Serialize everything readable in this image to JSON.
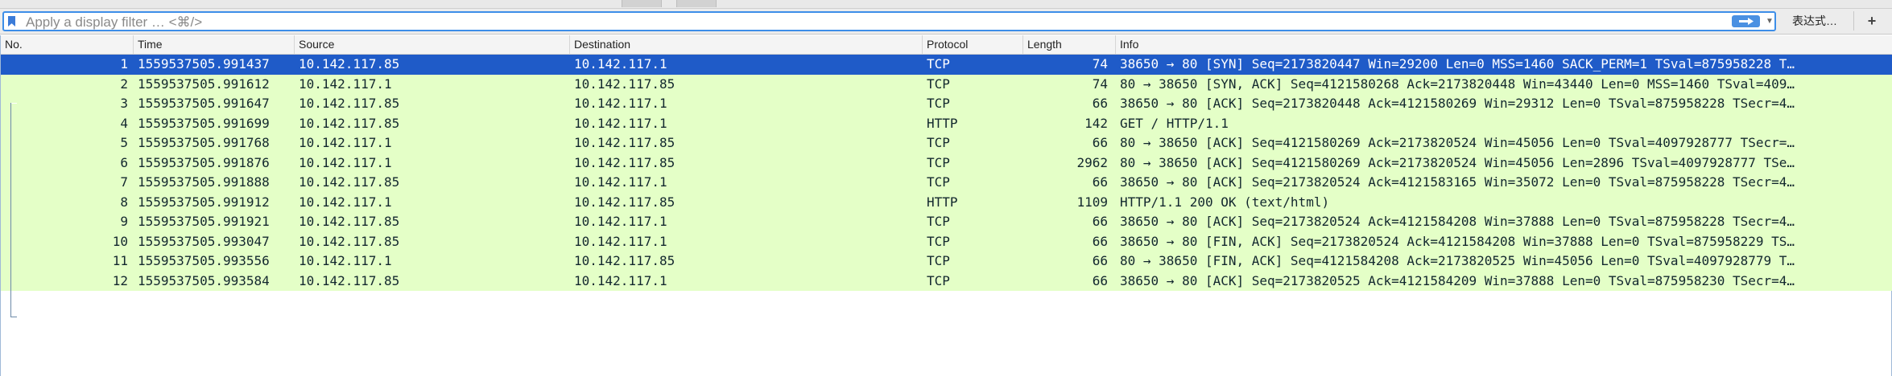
{
  "filter": {
    "placeholder": "Apply a display filter … <⌘/>",
    "expression_label": "表达式…",
    "plus_label": "+"
  },
  "columns": [
    "No.",
    "Time",
    "Source",
    "Destination",
    "Protocol",
    "Length",
    "Info"
  ],
  "packets": [
    {
      "no": "1",
      "time": "1559537505.991437",
      "source": "10.142.117.85",
      "destination": "10.142.117.1",
      "protocol": "TCP",
      "length": "74",
      "info": "38650 → 80 [SYN] Seq=2173820447 Win=29200 Len=0 MSS=1460 SACK_PERM=1 TSval=875958228 T…",
      "selected": true
    },
    {
      "no": "2",
      "time": "1559537505.991612",
      "source": "10.142.117.1",
      "destination": "10.142.117.85",
      "protocol": "TCP",
      "length": "74",
      "info": "80 → 38650 [SYN, ACK] Seq=4121580268 Ack=2173820448 Win=43440 Len=0 MSS=1460 TSval=409…"
    },
    {
      "no": "3",
      "time": "1559537505.991647",
      "source": "10.142.117.85",
      "destination": "10.142.117.1",
      "protocol": "TCP",
      "length": "66",
      "info": "38650 → 80 [ACK] Seq=2173820448 Ack=4121580269 Win=29312 Len=0 TSval=875958228 TSecr=4…"
    },
    {
      "no": "4",
      "time": "1559537505.991699",
      "source": "10.142.117.85",
      "destination": "10.142.117.1",
      "protocol": "HTTP",
      "length": "142",
      "info": "GET / HTTP/1.1"
    },
    {
      "no": "5",
      "time": "1559537505.991768",
      "source": "10.142.117.1",
      "destination": "10.142.117.85",
      "protocol": "TCP",
      "length": "66",
      "info": "80 → 38650 [ACK] Seq=4121580269 Ack=2173820524 Win=45056 Len=0 TSval=4097928777 TSecr=…"
    },
    {
      "no": "6",
      "time": "1559537505.991876",
      "source": "10.142.117.1",
      "destination": "10.142.117.85",
      "protocol": "TCP",
      "length": "2962",
      "info": "80 → 38650 [ACK] Seq=4121580269 Ack=2173820524 Win=45056 Len=2896 TSval=4097928777 TSe…"
    },
    {
      "no": "7",
      "time": "1559537505.991888",
      "source": "10.142.117.85",
      "destination": "10.142.117.1",
      "protocol": "TCP",
      "length": "66",
      "info": "38650 → 80 [ACK] Seq=2173820524 Ack=4121583165 Win=35072 Len=0 TSval=875958228 TSecr=4…"
    },
    {
      "no": "8",
      "time": "1559537505.991912",
      "source": "10.142.117.1",
      "destination": "10.142.117.85",
      "protocol": "HTTP",
      "length": "1109",
      "info": "HTTP/1.1 200 OK  (text/html)"
    },
    {
      "no": "9",
      "time": "1559537505.991921",
      "source": "10.142.117.85",
      "destination": "10.142.117.1",
      "protocol": "TCP",
      "length": "66",
      "info": "38650 → 80 [ACK] Seq=2173820524 Ack=4121584208 Win=37888 Len=0 TSval=875958228 TSecr=4…"
    },
    {
      "no": "10",
      "time": "1559537505.993047",
      "source": "10.142.117.85",
      "destination": "10.142.117.1",
      "protocol": "TCP",
      "length": "66",
      "info": "38650 → 80 [FIN, ACK] Seq=2173820524 Ack=4121584208 Win=37888 Len=0 TSval=875958229 TS…"
    },
    {
      "no": "11",
      "time": "1559537505.993556",
      "source": "10.142.117.1",
      "destination": "10.142.117.85",
      "protocol": "TCP",
      "length": "66",
      "info": "80 → 38650 [FIN, ACK] Seq=4121584208 Ack=2173820525 Win=45056 Len=0 TSval=4097928779 T…"
    },
    {
      "no": "12",
      "time": "1559537505.993584",
      "source": "10.142.117.85",
      "destination": "10.142.117.1",
      "protocol": "TCP",
      "length": "66",
      "info": "38650 → 80 [ACK] Seq=2173820525 Ack=4121584209 Win=37888 Len=0 TSval=875958230 TSecr=4…"
    }
  ],
  "colors": {
    "row_tcp_http": "#e4ffc7",
    "row_selected": "#1f5bc8",
    "filter_border": "#3d8ee8",
    "apply_button": "#4a90e2"
  }
}
